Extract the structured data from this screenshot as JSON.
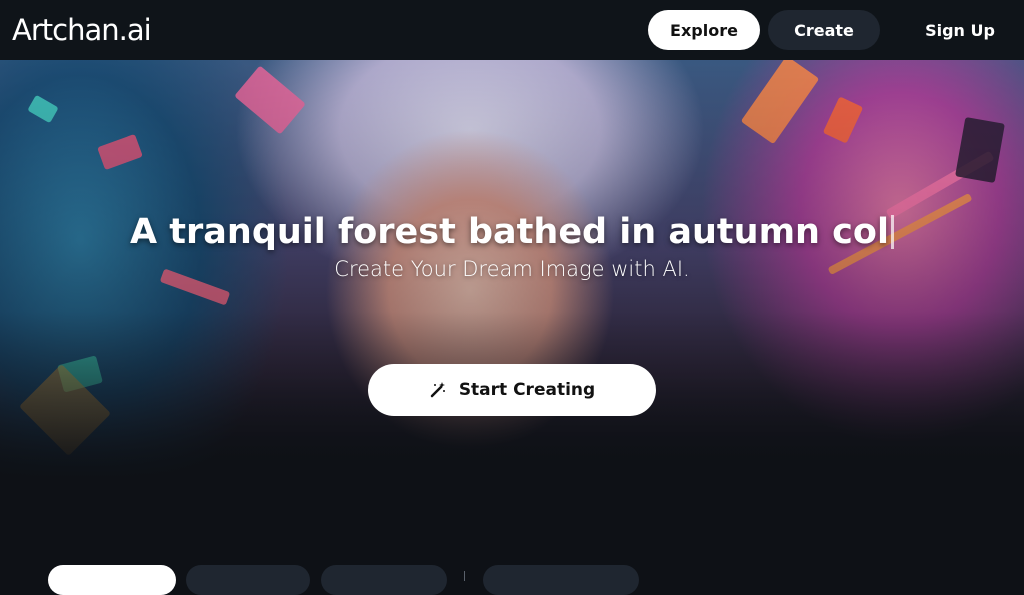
{
  "header": {
    "logo": "Artchan.ai",
    "nav": {
      "explore": "Explore",
      "create": "Create",
      "signup": "Sign Up"
    }
  },
  "hero": {
    "headline": "A tranquil forest bathed in autumn col",
    "subtitle": "Create Your Dream Image with AI.",
    "cta_label": "Start Creating",
    "cta_icon": "magic-wand-icon",
    "background": "anime-girl-with-headphones-colorful-splash"
  },
  "filter_tabs": {
    "count_visible": 4
  },
  "colors": {
    "page_bg": "#0e1116",
    "header_bg": "#0f1419",
    "primary_button": "#ffffff",
    "secondary_button": "#1f2630"
  }
}
